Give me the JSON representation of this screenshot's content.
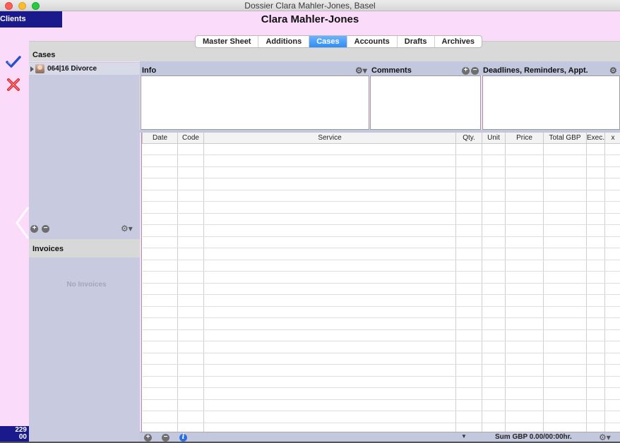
{
  "window": {
    "title": "Dossier Clara Mahler-Jones, Basel"
  },
  "header": {
    "clients_label": "Clients",
    "client_name": "Clara Mahler-Jones"
  },
  "tabs": [
    {
      "label": "Master Sheet",
      "active": false
    },
    {
      "label": "Additions",
      "active": false
    },
    {
      "label": "Cases",
      "active": true
    },
    {
      "label": "Accounts",
      "active": false
    },
    {
      "label": "Drafts",
      "active": false
    },
    {
      "label": "Archives",
      "active": false
    }
  ],
  "cases_panel": {
    "title": "Cases",
    "items": [
      {
        "label": "064|16 Divorce"
      }
    ]
  },
  "invoices_panel": {
    "title": "Invoices",
    "empty_text": "No Invoices"
  },
  "sections": {
    "info": "Info",
    "comments": "Comments",
    "deadlines": "Deadlines, Reminders, Appt."
  },
  "services_table": {
    "columns": [
      "Date",
      "Code",
      "Service",
      "Qty.",
      "Unit",
      "Price",
      "Total GBP",
      "Exec.",
      "x"
    ],
    "rows": []
  },
  "footer": {
    "sum_text": "Sum GBP 0.00/00:00hr.",
    "counter_top": "229",
    "counter_bottom": "00"
  },
  "colors": {
    "accent": "#2f8df5",
    "clients_bg": "#1a1a8c",
    "window_bg": "#fadcfa",
    "panel_bg": "#c8cbe0"
  }
}
